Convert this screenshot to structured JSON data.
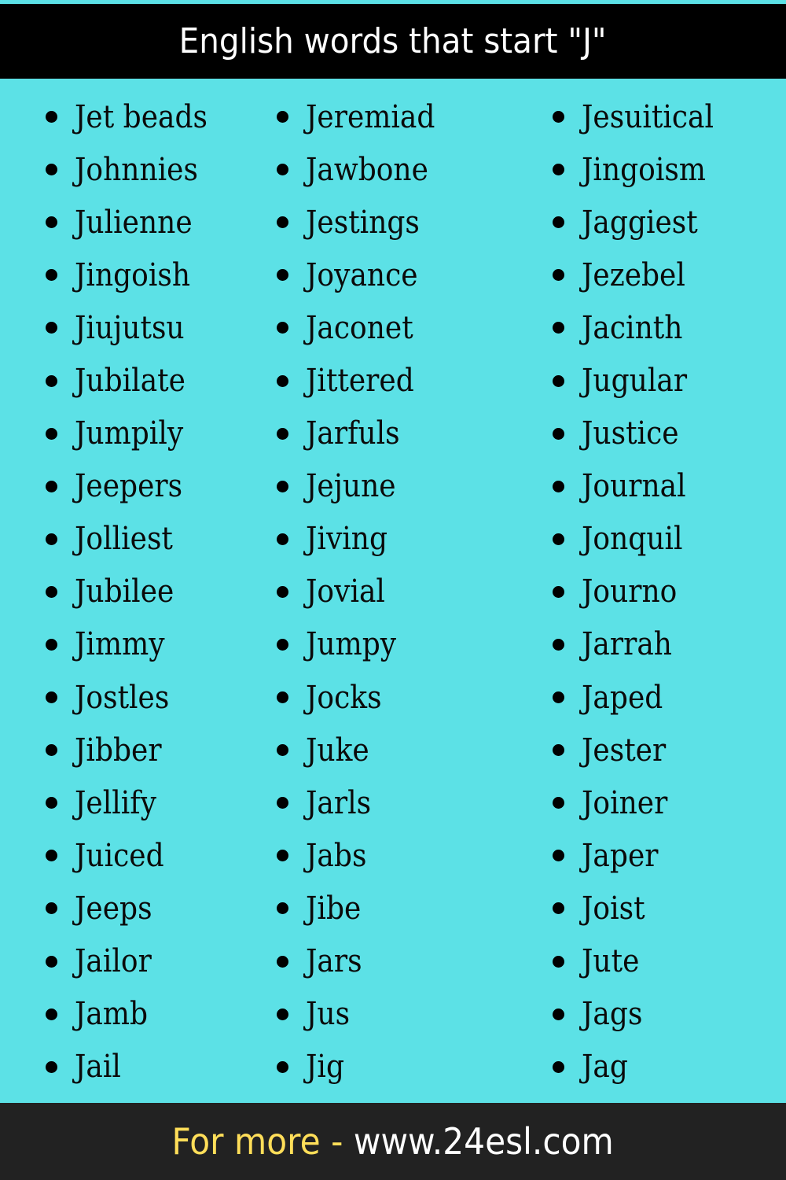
{
  "header": {
    "title": "English words that start \"J\""
  },
  "colors": {
    "background": "#5ce1e6",
    "header_bg": "#000000",
    "footer_bg": "#222222",
    "footer_prefix": "#ffde59",
    "footer_link": "#ffffff"
  },
  "columns": [
    {
      "words": [
        "Jet beads",
        "Johnnies",
        "Julienne",
        "Jingoish",
        "Jiujutsu",
        "Jubilate",
        "Jumpily",
        "Jeepers",
        "Jolliest",
        "Jubilee",
        "Jimmy",
        "Jostles",
        "Jibber",
        "Jellify",
        "Juiced",
        "Jeeps",
        "Jailor",
        "Jamb",
        "Jail"
      ]
    },
    {
      "words": [
        "Jeremiad",
        "Jawbone",
        "Jestings",
        "Joyance",
        "Jaconet",
        "Jittered",
        "Jarfuls",
        "Jejune",
        "Jiving",
        "Jovial",
        "Jumpy",
        "Jocks",
        "Juke",
        "Jarls",
        "Jabs",
        "Jibe",
        "Jars",
        "Jus",
        "Jig"
      ]
    },
    {
      "words": [
        "Jesuitical",
        "Jingoism",
        "Jaggiest",
        "Jezebel",
        "Jacinth",
        "Jugular",
        "Justice",
        "Journal",
        "Jonquil",
        "Journo",
        "Jarrah",
        "Japed",
        "Jester",
        "Joiner",
        "Japer",
        "Joist",
        "Jute",
        "Jags",
        "Jag"
      ]
    }
  ],
  "footer": {
    "prefix": "For more - ",
    "link": "www.24esl.com"
  }
}
